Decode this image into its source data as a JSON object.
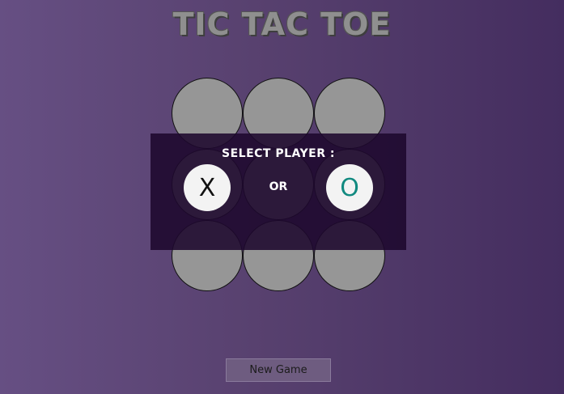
{
  "app": {
    "title": "TIC TAC TOE"
  },
  "board": {
    "cells": [
      "",
      "",
      "",
      "",
      "",
      "",
      "",
      "",
      ""
    ]
  },
  "player_select": {
    "label": "SELECT PLAYER :",
    "option_x": "X",
    "separator": "OR",
    "option_o": "O"
  },
  "controls": {
    "new_game_label": "New Game"
  },
  "colors": {
    "background_start": "#664f83",
    "background_end": "#442d5f",
    "cell": "#969696",
    "overlay": "#1e082d",
    "o_mark": "#128a80"
  }
}
